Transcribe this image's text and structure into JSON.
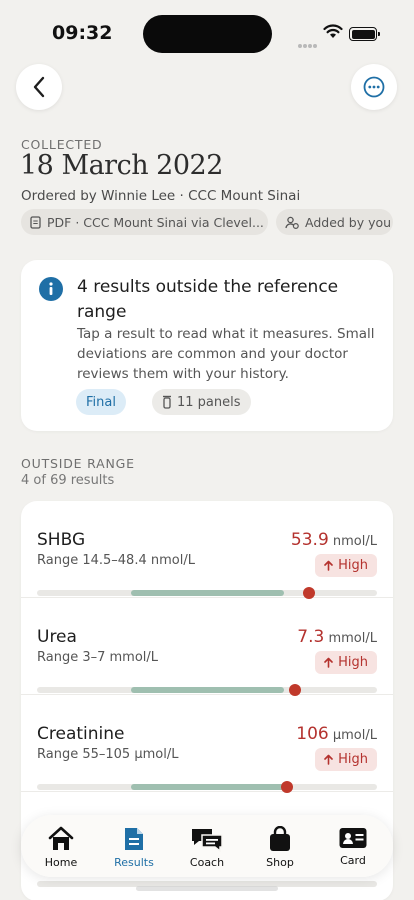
{
  "status_bar": {
    "time": "09:32"
  },
  "header": {
    "collected_label": "COLLECTED",
    "date": "18 March 2022",
    "ordered_by": "Ordered by Winnie Lee · CCC Mount Sinai",
    "chips": {
      "source": "PDF · CCC Mount Sinai via Clevel...",
      "added": "Added by you"
    }
  },
  "summary": {
    "title": "4 results outside the reference range",
    "body": "Tap a result to read what it measures. Small deviations are common and your doctor reviews them with your history.",
    "status_tag": "Final",
    "panels_tag": "11 panels"
  },
  "outside_range": {
    "label": "OUTSIDE RANGE",
    "count_text": "4 of 69 results",
    "results": [
      {
        "name": "SHBG",
        "range": "Range 14.5–48.4 nmol/L",
        "value": "53.9",
        "unit": "nmol/L",
        "flag": "High",
        "ref_low_pct": 0.275,
        "ref_high_pct": 0.725,
        "marker_pct": 0.8
      },
      {
        "name": "Urea",
        "range": "Range 3–7 mmol/L",
        "value": "7.3",
        "unit": "mmol/L",
        "flag": "High",
        "ref_low_pct": 0.275,
        "ref_high_pct": 0.725,
        "marker_pct": 0.76
      },
      {
        "name": "Creatinine",
        "range": "Range 55–105 µmol/L",
        "value": "106",
        "unit": "µmol/L",
        "flag": "High",
        "ref_low_pct": 0.275,
        "ref_high_pct": 0.725,
        "marker_pct": 0.735
      }
    ]
  },
  "tabbar": {
    "tabs": [
      {
        "label": "Home"
      },
      {
        "label": "Results"
      },
      {
        "label": "Coach"
      },
      {
        "label": "Shop"
      },
      {
        "label": "Card"
      }
    ],
    "active": "Results"
  },
  "colors": {
    "accent_blue": "#1f6fa6",
    "alert_red": "#b4322e",
    "in_range_green": "#9fbfb0",
    "background": "#f2f1ee"
  },
  "icons": {
    "back": "chevron-left-icon",
    "more": "more-horizontal-icon",
    "info": "info-icon",
    "pdf": "document-icon",
    "added": "user-sync-icon",
    "panels": "test-tube-icon",
    "flag": "arrow-up-icon"
  }
}
